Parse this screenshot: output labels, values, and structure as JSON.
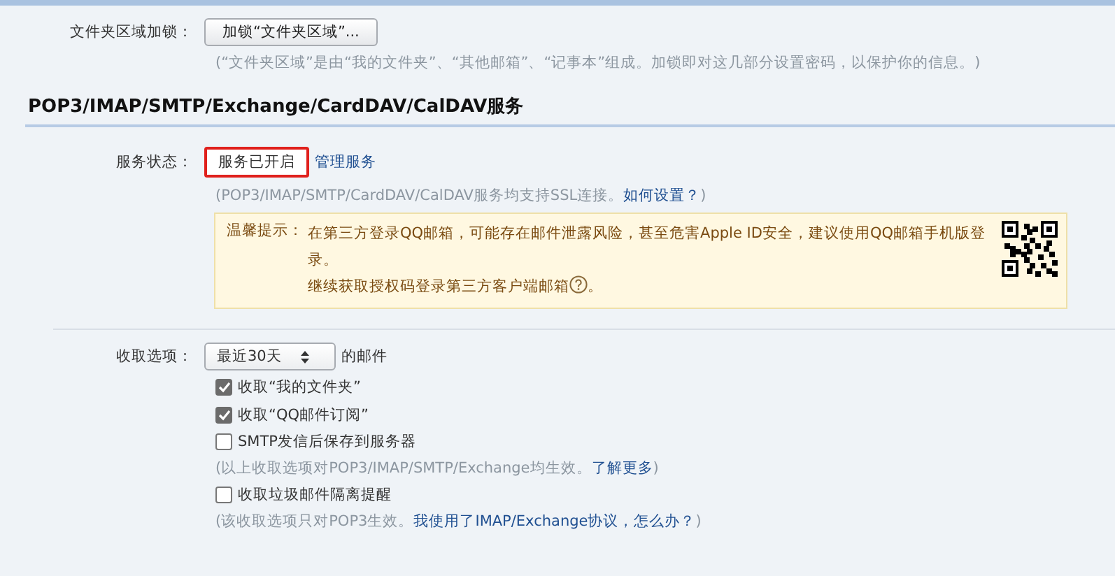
{
  "folder_lock": {
    "label": "文件夹区域加锁：",
    "button": "加锁“文件夹区域”...",
    "note": "(“文件夹区域”是由“我的文件夹”、“其他邮箱”、“记事本”组成。加锁即对这几部分设置密码，以保护你的信息。)"
  },
  "section": {
    "title": "POP3/IMAP/SMTP/Exchange/CardDAV/CalDAV服务"
  },
  "service": {
    "label": "服务状态：",
    "status": "服务已开启",
    "status_highlighted": true,
    "manage_link": "管理服务",
    "note": {
      "before": "(POP3/IMAP/SMTP/CardDAV/CalDAV服务均支持SSL连接。",
      "link": "如何设置？",
      "after": ")"
    }
  },
  "tip": {
    "label": "温馨提示：",
    "lines": [
      {
        "text": "在第三方登录QQ邮箱，可能存在邮件泄露风险，甚至危害Apple ID安全，建议使用QQ邮箱手机版登录。"
      },
      {
        "text": "继续获取授权码登录第三方客户端邮箱",
        "help_icon": true,
        "after": "。"
      }
    ]
  },
  "fetch": {
    "label": "收取选项：",
    "select": "最近30天",
    "suffix": "的邮件",
    "options": [
      {
        "kind": "checkbox",
        "label": "收取“我的文件夹”",
        "checked": true
      },
      {
        "kind": "checkbox",
        "label": "收取“QQ邮件订阅”",
        "checked": true
      },
      {
        "kind": "checkbox",
        "label": "SMTP发信后保存到服务器",
        "checked": false
      },
      {
        "kind": "note",
        "before": "(以上收取选项对POP3/IMAP/SMTP/Exchange均生效。",
        "link": "了解更多",
        "after": ")"
      },
      {
        "kind": "checkbox",
        "label": "收取垃圾邮件隔离提醒",
        "checked": false
      },
      {
        "kind": "note",
        "before": "(该收取选项只对POP3生效。",
        "link": "我使用了IMAP/Exchange协议，怎么办？",
        "after": ")"
      }
    ]
  }
}
